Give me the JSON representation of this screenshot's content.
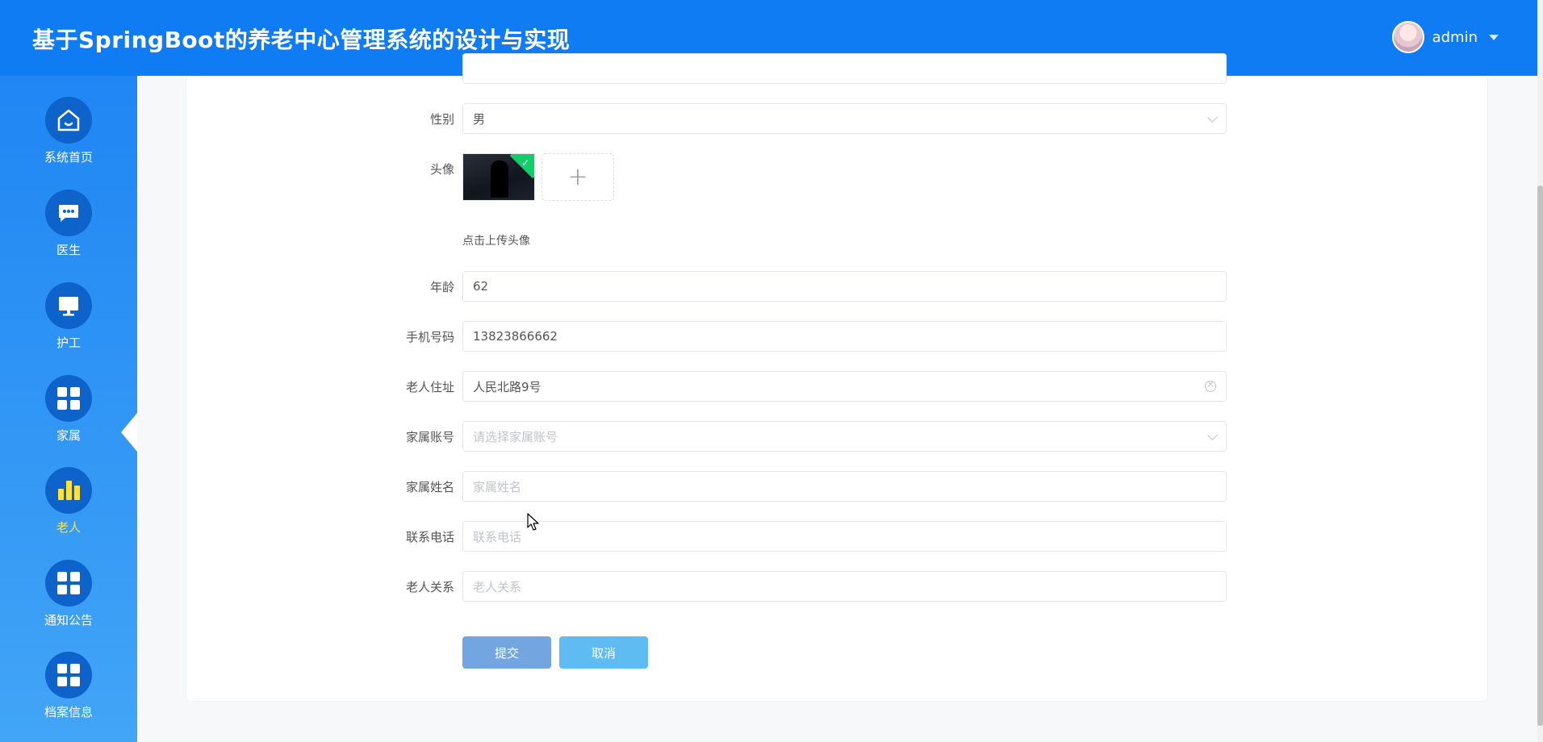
{
  "header": {
    "title": "基于SpringBoot的养老中心管理系统的设计与实现",
    "username": "admin"
  },
  "sidebar": {
    "items": [
      {
        "label": "系统首页",
        "icon": "home-icon"
      },
      {
        "label": "医生",
        "icon": "chat-icon"
      },
      {
        "label": "护工",
        "icon": "monitor-icon"
      },
      {
        "label": "家属",
        "icon": "grid-icon"
      },
      {
        "label": "老人",
        "icon": "bar-chart-icon",
        "active": true
      },
      {
        "label": "通知公告",
        "icon": "grid-icon"
      },
      {
        "label": "档案信息",
        "icon": "grid-icon"
      }
    ]
  },
  "form": {
    "gender": {
      "label": "性别",
      "value": "男"
    },
    "avatar": {
      "label": "头像",
      "hint": "点击上传头像"
    },
    "age": {
      "label": "年龄",
      "value": "62"
    },
    "phone": {
      "label": "手机号码",
      "value": "13823866662"
    },
    "address": {
      "label": "老人住址",
      "value": "人民北路9号"
    },
    "family_account": {
      "label": "家属账号",
      "placeholder": "请选择家属账号"
    },
    "family_name": {
      "label": "家属姓名",
      "placeholder": "家属姓名"
    },
    "contact_phone": {
      "label": "联系电话",
      "placeholder": "联系电话"
    },
    "relation": {
      "label": "老人关系",
      "placeholder": "老人关系"
    },
    "submit_label": "提交",
    "cancel_label": "取消"
  },
  "colors": {
    "header_bg": "#0f7cf4",
    "active_nav": "#ffe03c",
    "submit_btn": "#73a6e0",
    "cancel_btn": "#5fbcf2",
    "upload_success": "#13ce66"
  }
}
